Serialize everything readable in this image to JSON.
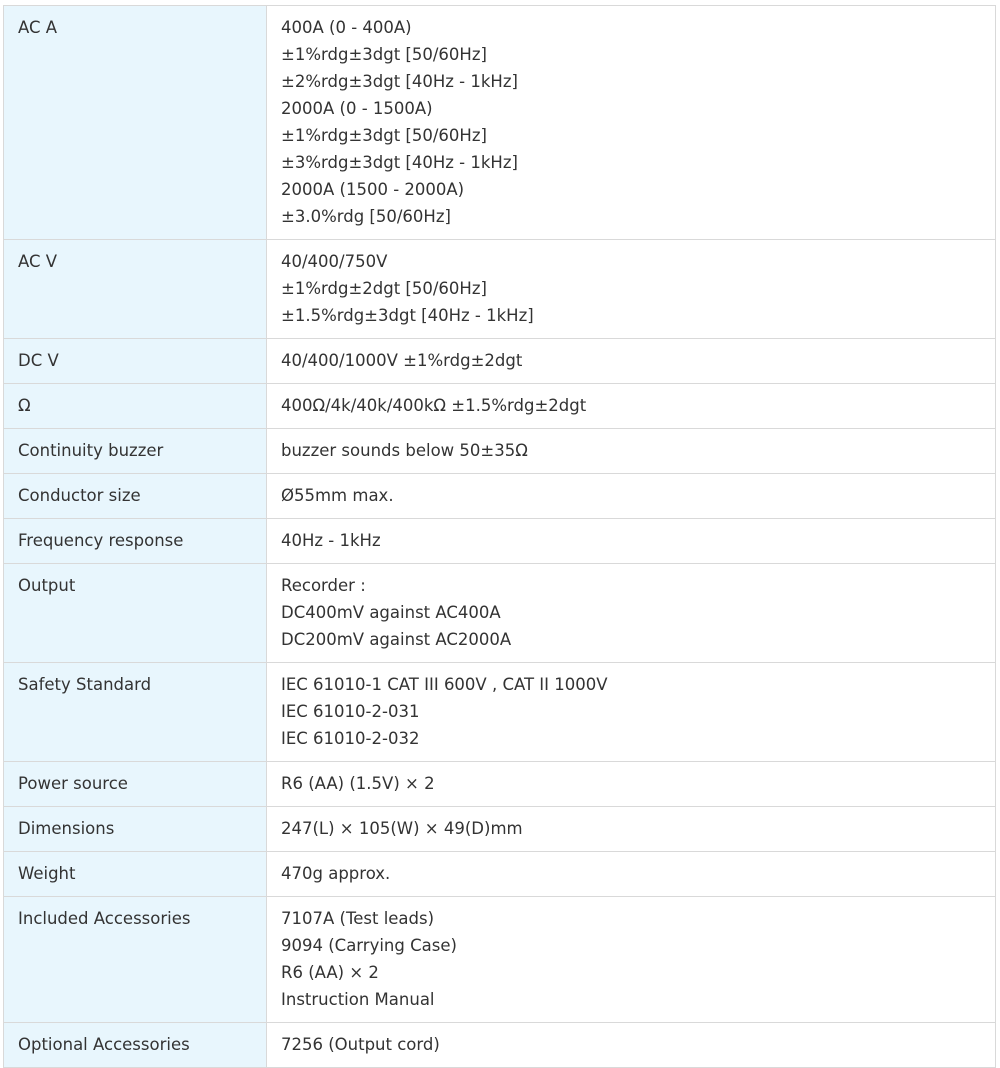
{
  "specs": [
    {
      "label": "AC A",
      "lines": [
        "400A (0 - 400A)",
        "±1%rdg±3dgt [50/60Hz]",
        "±2%rdg±3dgt [40Hz - 1kHz]",
        "2000A (0 - 1500A)",
        "±1%rdg±3dgt [50/60Hz]",
        "±3%rdg±3dgt [40Hz - 1kHz]",
        "2000A (1500 - 2000A)",
        "±3.0%rdg [50/60Hz]"
      ]
    },
    {
      "label": "AC V",
      "lines": [
        "40/400/750V",
        "±1%rdg±2dgt [50/60Hz]",
        "±1.5%rdg±3dgt [40Hz - 1kHz]"
      ]
    },
    {
      "label": "DC V",
      "lines": [
        "40/400/1000V ±1%rdg±2dgt"
      ]
    },
    {
      "label": "Ω",
      "lines": [
        "400Ω/4k/40k/400kΩ ±1.5%rdg±2dgt"
      ]
    },
    {
      "label": "Continuity buzzer",
      "lines": [
        "buzzer sounds below 50±35Ω"
      ]
    },
    {
      "label": "Conductor size",
      "lines": [
        "Ø55mm max."
      ]
    },
    {
      "label": "Frequency response",
      "lines": [
        "40Hz - 1kHz"
      ]
    },
    {
      "label": "Output",
      "lines": [
        "Recorder :",
        "DC400mV against AC400A",
        "DC200mV against AC2000A"
      ]
    },
    {
      "label": "Safety Standard",
      "lines": [
        "IEC 61010-1 CAT III 600V , CAT II 1000V",
        "IEC 61010-2-031",
        "IEC 61010-2-032"
      ]
    },
    {
      "label": "Power source",
      "lines": [
        "R6 (AA) (1.5V) × 2"
      ]
    },
    {
      "label": "Dimensions",
      "lines": [
        "247(L) × 105(W) × 49(D)mm"
      ]
    },
    {
      "label": "Weight",
      "lines": [
        "470g approx."
      ]
    },
    {
      "label": "Included Accessories",
      "lines": [
        "7107A (Test leads)",
        "9094 (Carrying Case)",
        "R6 (AA) × 2",
        "Instruction Manual"
      ]
    },
    {
      "label": "Optional Accessories",
      "lines": [
        "7256 (Output cord)"
      ]
    }
  ]
}
